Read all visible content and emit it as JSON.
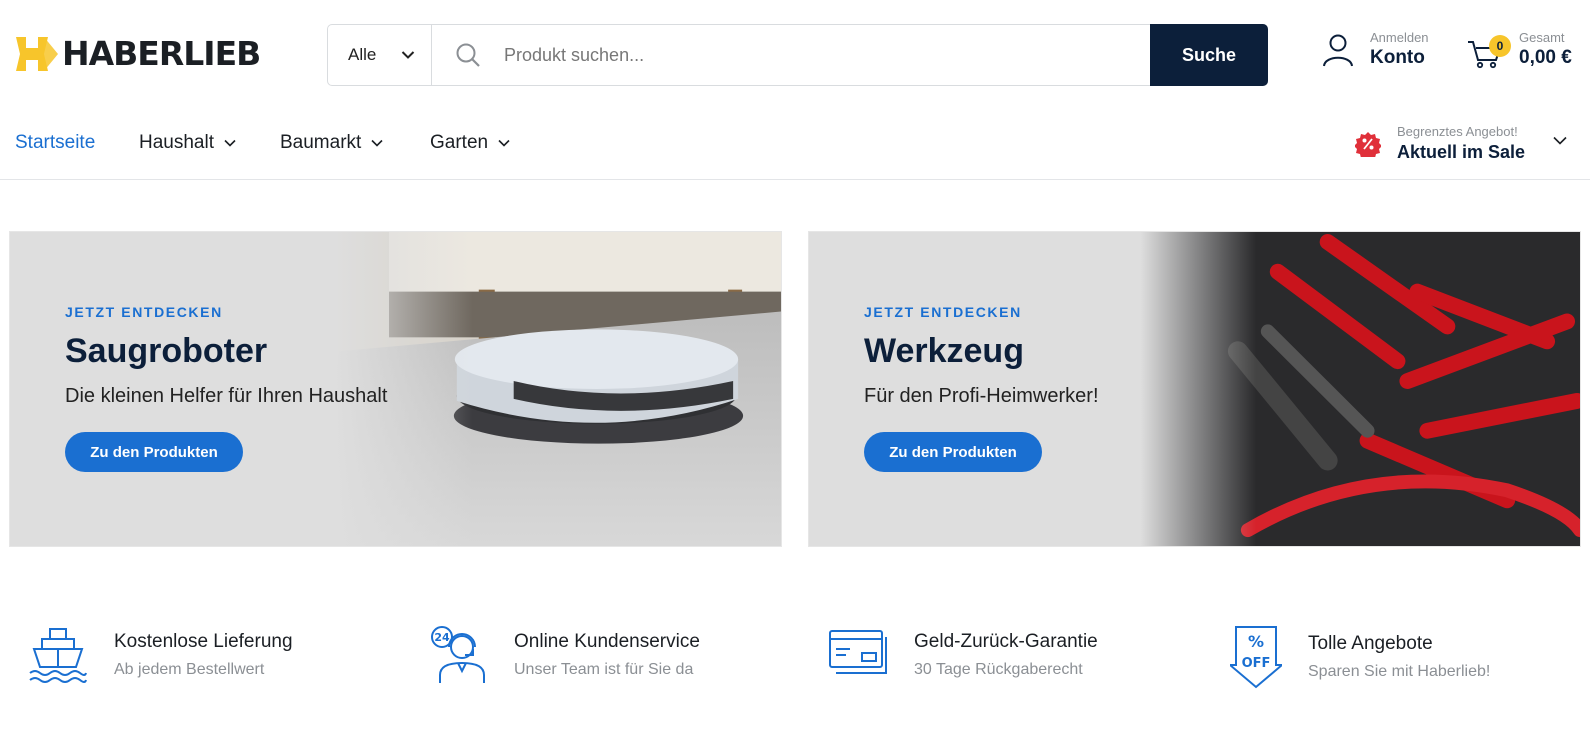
{
  "brand": {
    "name": "HABERLIEB",
    "accent": "#f7c52b",
    "primary": "#0c1f3a",
    "link": "#1a6fd1"
  },
  "search": {
    "category": "Alle",
    "placeholder": "Produkt suchen...",
    "button_label": "Suche"
  },
  "account": {
    "small_label": "Anmelden",
    "label": "Konto",
    "icon": "user-icon"
  },
  "cart": {
    "count": "0",
    "small_label": "Gesamt",
    "total": "0,00 €",
    "icon": "cart-icon"
  },
  "nav": {
    "items": [
      {
        "label": "Startseite",
        "active": true
      },
      {
        "label": "Haushalt",
        "dropdown": true
      },
      {
        "label": "Baumarkt",
        "dropdown": true
      },
      {
        "label": "Garten",
        "dropdown": true
      }
    ],
    "sale": {
      "small_label": "Begrenztes Angebot!",
      "label": "Aktuell im Sale",
      "icon": "percent-badge-icon"
    }
  },
  "banners": [
    {
      "eyebrow": "JETZT ENTDECKEN",
      "title": "Saugroboter",
      "subtitle": "Die kleinen Helfer für Ihren Haushalt",
      "cta": "Zu den Produkten"
    },
    {
      "eyebrow": "JETZT ENTDECKEN",
      "title": "Werkzeug",
      "subtitle": "Für den Profi-Heimwerker!",
      "cta": "Zu den Produkten"
    }
  ],
  "features": [
    {
      "icon": "ship-icon",
      "title": "Kostenlose Lieferung",
      "subtitle": "Ab jedem Bestellwert"
    },
    {
      "icon": "headset-24-icon",
      "title": "Online Kundenservice",
      "subtitle": "Unser Team ist für Sie da"
    },
    {
      "icon": "credit-card-icon",
      "title": "Geld-Zurück-Garantie",
      "subtitle": "30 Tage Rückgaberecht"
    },
    {
      "icon": "percent-off-tag-icon",
      "title": "Tolle Angebote",
      "subtitle": "Sparen Sie mit Haberlieb!"
    }
  ]
}
